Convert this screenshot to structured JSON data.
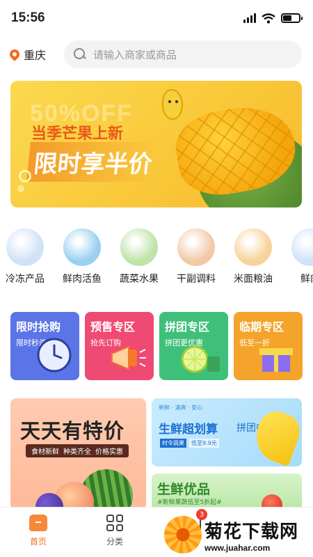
{
  "status_bar": {
    "time": "15:56"
  },
  "header": {
    "location": "重庆",
    "search_placeholder": "请输入商家或商品"
  },
  "banner": {
    "bg_text": "50%OFF",
    "line1": "当季芒果上新",
    "line2": "限时享半价"
  },
  "categories": [
    {
      "label": "冷冻产品",
      "color": "#cfe2f7"
    },
    {
      "label": "鲜肉活鱼",
      "color": "#9ad0f0"
    },
    {
      "label": "蔬菜水果",
      "color": "#bfe3a8"
    },
    {
      "label": "干副调料",
      "color": "#f1c9a5"
    },
    {
      "label": "米面粮油",
      "color": "#f7d39a"
    },
    {
      "label": "鲜肉",
      "color": "#cfe2f7"
    }
  ],
  "promos": [
    {
      "title": "限时抢购",
      "sub": "限时秒杀",
      "color": "#5b74e6"
    },
    {
      "title": "预售专区",
      "sub": "抢先订购",
      "color": "#ef4a73"
    },
    {
      "title": "拼团专区",
      "sub": "拼团更优惠",
      "color": "#3fc07a"
    },
    {
      "title": "临期专区",
      "sub": "低至一折",
      "color": "#f4a42a"
    }
  ],
  "panel_left": {
    "title": "天天有特价",
    "tags": [
      "食材新鲜",
      "种类齐全",
      "价格实惠"
    ]
  },
  "panel_right_top": {
    "tiny": "新鲜 · 清爽 · 安心",
    "title": "生鲜超划算",
    "title2": "拼团中",
    "tag1": "时令蔬果",
    "tag2": "低至9.9元"
  },
  "panel_right_bottom": {
    "title": "生鲜优品",
    "sub": "#新鲜果蔬低至5折起#"
  },
  "tabbar": {
    "home": "首页",
    "category": "分类",
    "cart_badge": "3"
  },
  "watermark": {
    "cn": "菊花下载网",
    "url": "www.juahar.com"
  }
}
